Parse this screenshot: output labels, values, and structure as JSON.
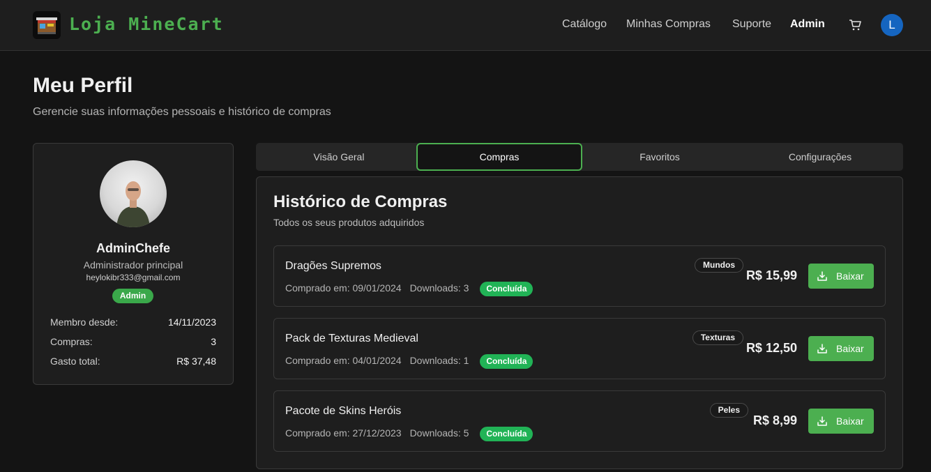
{
  "header": {
    "brand": "Loja MineCart",
    "nav": [
      "Catálogo",
      "Minhas Compras",
      "Suporte",
      "Admin"
    ],
    "user_initial": "L",
    "accent_color": "#4caf50"
  },
  "page": {
    "title": "Meu Perfil",
    "subtitle": "Gerencie suas informações pessoais e histórico de compras"
  },
  "profile": {
    "username": "AdminChefe",
    "role": "Administrador principal",
    "email": "heylokibr333@gmail.com",
    "badge": "Admin",
    "stats": [
      {
        "label": "Membro desde:",
        "value": "14/11/2023"
      },
      {
        "label": "Compras:",
        "value": "3"
      },
      {
        "label": "Gasto total:",
        "value": "R$ 37,48"
      }
    ]
  },
  "tabs": [
    "Visão Geral",
    "Compras",
    "Favoritos",
    "Configurações"
  ],
  "purchases": {
    "title": "Histórico de Compras",
    "subtitle": "Todos os seus produtos adquiridos",
    "download_label": "Baixar",
    "items": [
      {
        "name": "Dragões Supremos",
        "date": "Comprado em: 09/01/2024",
        "downloads": "Downloads: 3",
        "status": "Concluída",
        "category": "Mundos",
        "price": "R$ 15,99"
      },
      {
        "name": "Pack de Texturas Medieval",
        "date": "Comprado em: 04/01/2024",
        "downloads": "Downloads: 1",
        "status": "Concluída",
        "category": "Texturas",
        "price": "R$ 12,50"
      },
      {
        "name": "Pacote de Skins Heróis",
        "date": "Comprado em: 27/12/2023",
        "downloads": "Downloads: 5",
        "status": "Concluída",
        "category": "Peles",
        "price": "R$ 8,99"
      }
    ]
  }
}
